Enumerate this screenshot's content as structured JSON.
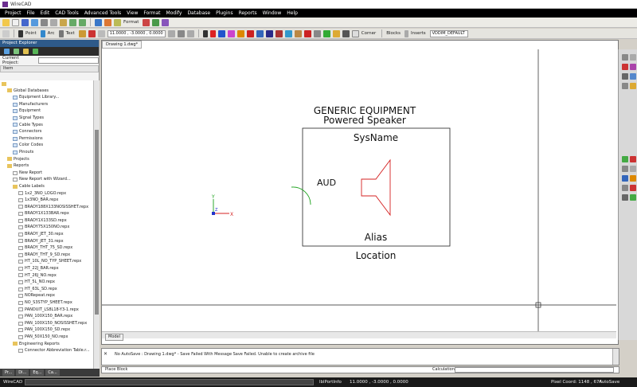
{
  "window": {
    "title": "WireCAD"
  },
  "menu": [
    "Project",
    "File",
    "Edit",
    "CAD Tools",
    "Advanced Tools",
    "View",
    "Format",
    "Modify",
    "Database",
    "Plugins",
    "Reports",
    "Window",
    "Help"
  ],
  "toolbar2": {
    "point_label": "Point",
    "arc_label": "Arc",
    "text_label": "Text",
    "coords": "11.0000 , -3.0000 , 0.0000",
    "corner_label": "Corner",
    "blocks_label": "Blocks",
    "inserts_label": "Inserts",
    "style_value": "VDDIM_DEFAULT"
  },
  "toolbar1": {
    "format_label": "Format"
  },
  "project_explorer": {
    "title": "Project Explorer",
    "current_project_label": "Current Project:",
    "column_header": "Item",
    "tree": [
      {
        "label": "",
        "indent": 0,
        "icon": "folder"
      },
      {
        "label": "Global Databases",
        "indent": 1,
        "icon": "folder"
      },
      {
        "label": "Equipment Library...",
        "indent": 2,
        "icon": "page"
      },
      {
        "label": "Manufacturers",
        "indent": 2,
        "icon": "page"
      },
      {
        "label": "Equipment",
        "indent": 2,
        "icon": "page"
      },
      {
        "label": "Signal Types",
        "indent": 2,
        "icon": "page"
      },
      {
        "label": "Cable Types",
        "indent": 2,
        "icon": "page"
      },
      {
        "label": "Connectors",
        "indent": 2,
        "icon": "page"
      },
      {
        "label": "Permissions",
        "indent": 2,
        "icon": "page"
      },
      {
        "label": "Color Codes",
        "indent": 2,
        "icon": "page"
      },
      {
        "label": "Pinouts",
        "indent": 2,
        "icon": "page"
      },
      {
        "label": "Projects",
        "indent": 1,
        "icon": "folder"
      },
      {
        "label": "Reports",
        "indent": 1,
        "icon": "folder"
      },
      {
        "label": "New Report",
        "indent": 2,
        "icon": "rpt"
      },
      {
        "label": "New Report with Wizard...",
        "indent": 2,
        "icon": "rpt"
      },
      {
        "label": "Cable Labels",
        "indent": 2,
        "icon": "folder"
      },
      {
        "label": "1x2_3NO_LOGO.repx",
        "indent": 3,
        "icon": "rpt"
      },
      {
        "label": "1x3NO_BAR.repx",
        "indent": 3,
        "icon": "rpt"
      },
      {
        "label": "BRADY188X133NOSISSHET.repx",
        "indent": 3,
        "icon": "rpt"
      },
      {
        "label": "BRADY1X133BAR.repx",
        "indent": 3,
        "icon": "rpt"
      },
      {
        "label": "BRADY1X133SD.repx",
        "indent": 3,
        "icon": "rpt"
      },
      {
        "label": "BRADY75X150NO.repx",
        "indent": 3,
        "icon": "rpt"
      },
      {
        "label": "BRADY_JET_30.repx",
        "indent": 3,
        "icon": "rpt"
      },
      {
        "label": "BRADY_JET_31.repx",
        "indent": 3,
        "icon": "rpt"
      },
      {
        "label": "BRADY_THT_75_SD.repx",
        "indent": 3,
        "icon": "rpt"
      },
      {
        "label": "BRADY_THT_9_SD.repx",
        "indent": 3,
        "icon": "rpt"
      },
      {
        "label": "HT_10L_NO_TYP_SHEET.repx",
        "indent": 3,
        "icon": "rpt"
      },
      {
        "label": "HT_22J_BAR.repx",
        "indent": 3,
        "icon": "rpt"
      },
      {
        "label": "HT_26J_NO.repx",
        "indent": 3,
        "icon": "rpt"
      },
      {
        "label": "HT_5L_NO.repx",
        "indent": 3,
        "icon": "rpt"
      },
      {
        "label": "HT_63L_SD.repx",
        "indent": 3,
        "icon": "rpt"
      },
      {
        "label": "NORepeat.repx",
        "indent": 3,
        "icon": "rpt"
      },
      {
        "label": "NO_S3STYP_SHEET.repx",
        "indent": 3,
        "icon": "rpt"
      },
      {
        "label": "PANDUIT_LS8L18-Y3-1.repx",
        "indent": 3,
        "icon": "rpt"
      },
      {
        "label": "PAN_100X150_BAR.repx",
        "indent": 3,
        "icon": "rpt"
      },
      {
        "label": "PAN_100X150_NOSISSHET.repx",
        "indent": 3,
        "icon": "rpt"
      },
      {
        "label": "PAN_100X150_SD.repx",
        "indent": 3,
        "icon": "rpt"
      },
      {
        "label": "PAN_50X150_NO.repx",
        "indent": 3,
        "icon": "rpt"
      },
      {
        "label": "Engineering Reports",
        "indent": 2,
        "icon": "folder"
      },
      {
        "label": "Connector Abbreviation Table.r...",
        "indent": 3,
        "icon": "rpt"
      }
    ],
    "tabs": [
      "Pr...",
      "Di...",
      "Eq...",
      "Ca..."
    ]
  },
  "document": {
    "tab_label": "Drawing 1.dwg*",
    "model_tab": "Model"
  },
  "drawing": {
    "header_line1": "GENERIC EQUIPMENT",
    "header_line2": "Powered Speaker",
    "sysname": "SysName",
    "port": "AUD",
    "alias": "Alias",
    "location": "Location",
    "axis_x": "X",
    "axis_y": "Y",
    "axis_z": "Z"
  },
  "command": {
    "message": "No AutoSave : Drawing 1.dwg* - Save Failed With Message Save Failed. Unable to create archive file",
    "prompt": "Place Block",
    "calculation_label": "Calculation"
  },
  "status": {
    "app": "WireCAD",
    "port_info": "lblPortInfo",
    "coords": "11.0000 , -3.0000 , 0.0000",
    "pixel_coord": "Pixel Coord: 1148 , 674",
    "autosave": "AutoSave In:09:50"
  },
  "colors": {
    "accent_panel": "#2e5a8a",
    "symbol_red": "#d42020",
    "wire_green": "#18a018"
  }
}
